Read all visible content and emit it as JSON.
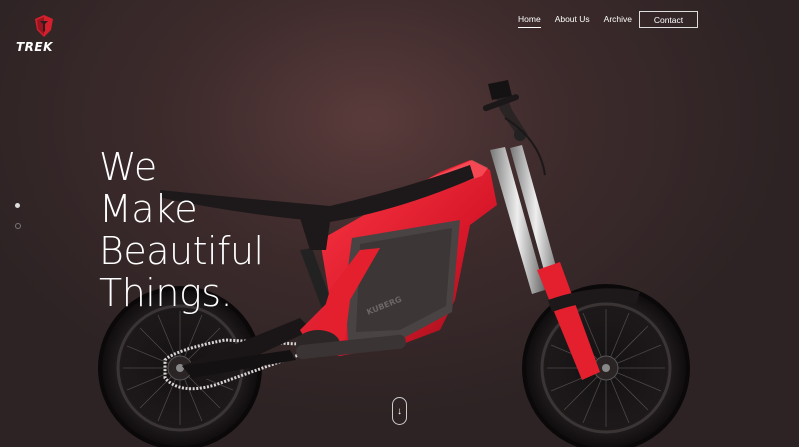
{
  "brand": {
    "name": "TREK"
  },
  "nav": {
    "items": [
      {
        "label": "Home",
        "active": true
      },
      {
        "label": "About Us",
        "active": false
      },
      {
        "label": "Archive",
        "active": false
      }
    ],
    "contact_label": "Contact"
  },
  "hero": {
    "lines": [
      "We",
      "Make",
      "Beautiful",
      "Things."
    ],
    "bike_label": "KUBERG"
  },
  "slider": {
    "dots": 2,
    "active_index": 0
  },
  "scroll": {
    "icon": "arrow-down-icon",
    "glyph": "↓"
  },
  "colors": {
    "accent": "#e4202e",
    "background": "#3a2a2b"
  }
}
